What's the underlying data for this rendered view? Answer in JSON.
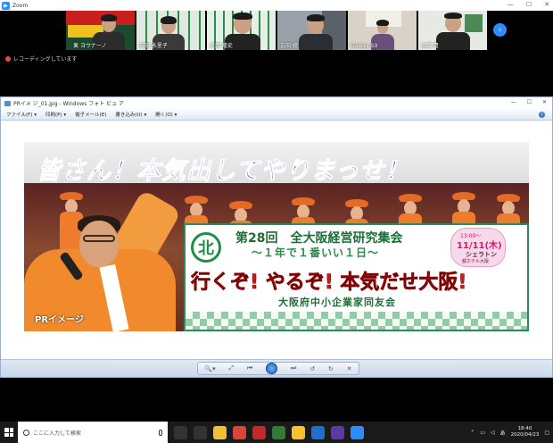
{
  "window": {
    "app_title": "Zoom",
    "minimize_glyph": "—",
    "maximize_glyph": "☐",
    "close_glyph": "✕"
  },
  "participants": [
    {
      "name": "東 ヨウナーノ"
    },
    {
      "name": "吉田 永里子"
    },
    {
      "name": "大西 隆史"
    },
    {
      "name": "吉田 修"
    },
    {
      "name": "Galaxy S9"
    },
    {
      "name": "山口 豊"
    }
  ],
  "next_page_glyph": "›",
  "recording": {
    "text": "レコーディングしています"
  },
  "viewer": {
    "title": "PRイメ ジ_01.jpg - Windows フォト ビュ ア",
    "menus": [
      {
        "label": "ファイル(F) ▾"
      },
      {
        "label": "印刷(P) ▾"
      },
      {
        "label": "電子メール(E)"
      },
      {
        "label": "書き込み(U) ▾"
      },
      {
        "label": "開く(O) ▾"
      }
    ],
    "help_glyph": "?",
    "controls": {
      "zoom": "🔍▾",
      "fit": "⤢",
      "prev": "⏮",
      "slideshow": "",
      "next": "⏭",
      "rotate_ccw": "↺",
      "rotate_cw": "↻",
      "delete": "✕"
    }
  },
  "banner": {
    "headline": "皆さん！本気出してやりまっせ！",
    "board_logo": "北",
    "board_title": "第28回　全大阪経営研究集会",
    "board_subtitle": "〜１年で１番いい１日〜",
    "board_slogan": "行くぞ! やるぞ! 本気だせ大阪!",
    "board_org": "大阪府中小企業家同友会",
    "date_time": "13:00〜",
    "date_main": "11/11(木)",
    "date_venue": "シェラトン",
    "date_venue2": "都ホテル大阪",
    "pr_label": "PRイメージ"
  },
  "taskbar": {
    "search_placeholder": "ここに入力して検索",
    "clock_time": "18:40",
    "clock_date": "2020/04/23",
    "ime": "あ",
    "tray_caret": "⌃",
    "icons": [
      {
        "name": "task-view",
        "color": "#333333"
      },
      {
        "name": "microphone",
        "color": "#333333"
      },
      {
        "name": "file-explorer",
        "color": "#f2c037"
      },
      {
        "name": "chrome",
        "color": "#db4437"
      },
      {
        "name": "app-red",
        "color": "#c62828"
      },
      {
        "name": "app-green",
        "color": "#2e7d32"
      },
      {
        "name": "app-yellow",
        "color": "#fbc02d"
      },
      {
        "name": "edge",
        "color": "#1e6fd0"
      },
      {
        "name": "photos",
        "color": "#5c3aa3"
      },
      {
        "name": "zoom",
        "color": "#2d8cff"
      }
    ]
  },
  "colors": {
    "zoom_blue": "#2d8cff",
    "headline_blue": "#1d3fd0",
    "slogan_red": "#d01818",
    "board_green": "#1a6e35"
  }
}
